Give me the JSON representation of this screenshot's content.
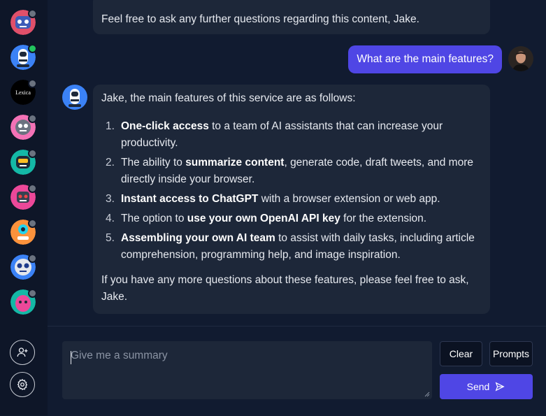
{
  "sidebar": {
    "assistants": [
      {
        "name": "robot-red-blue",
        "status": "offline"
      },
      {
        "name": "robot-astronaut",
        "status": "online"
      },
      {
        "name": "lexica",
        "label": "Lexica",
        "status": "offline"
      },
      {
        "name": "robot-pink-gear",
        "status": "offline"
      },
      {
        "name": "robot-green",
        "status": "offline"
      },
      {
        "name": "robot-pink-red",
        "status": "offline"
      },
      {
        "name": "robot-orange",
        "status": "offline"
      },
      {
        "name": "robot-blue",
        "status": "offline"
      },
      {
        "name": "robot-pink-bug",
        "status": "offline"
      }
    ],
    "add_user_icon": "add-user-icon",
    "settings_icon": "gear-icon"
  },
  "chat": {
    "prev_bot_message": "Feel free to ask any further questions regarding this content, Jake.",
    "user_message": "What are the main features?",
    "bot_intro": "Jake, the main features of this service are as follows:",
    "features": [
      {
        "num": "1.",
        "bold": "One-click access",
        "rest": " to a team of AI assistants that can increase your productivity."
      },
      {
        "num": "2.",
        "pre": "The ability to ",
        "bold": "summarize content",
        "rest": ", generate code, draft tweets, and more directly inside your browser."
      },
      {
        "num": "3.",
        "bold": "Instant access to ChatGPT",
        "rest": " with a browser extension or web app."
      },
      {
        "num": "4.",
        "pre": "The option to ",
        "bold": "use your own OpenAI API key",
        "rest": " for the extension."
      },
      {
        "num": "5.",
        "bold": "Assembling your own AI team",
        "rest": " to assist with daily tasks, including article comprehension, programming help, and image inspiration."
      }
    ],
    "bot_outro": "If you have any more questions about these features, please feel free to ask, Jake."
  },
  "composer": {
    "placeholder": "Give me a summary",
    "clear_label": "Clear",
    "prompts_label": "Prompts",
    "send_label": "Send",
    "send_icon": "send-icon"
  },
  "colors": {
    "accent": "#4f46e5",
    "background": "#111b30",
    "bubble": "#1d2739",
    "online": "#22c55e"
  }
}
